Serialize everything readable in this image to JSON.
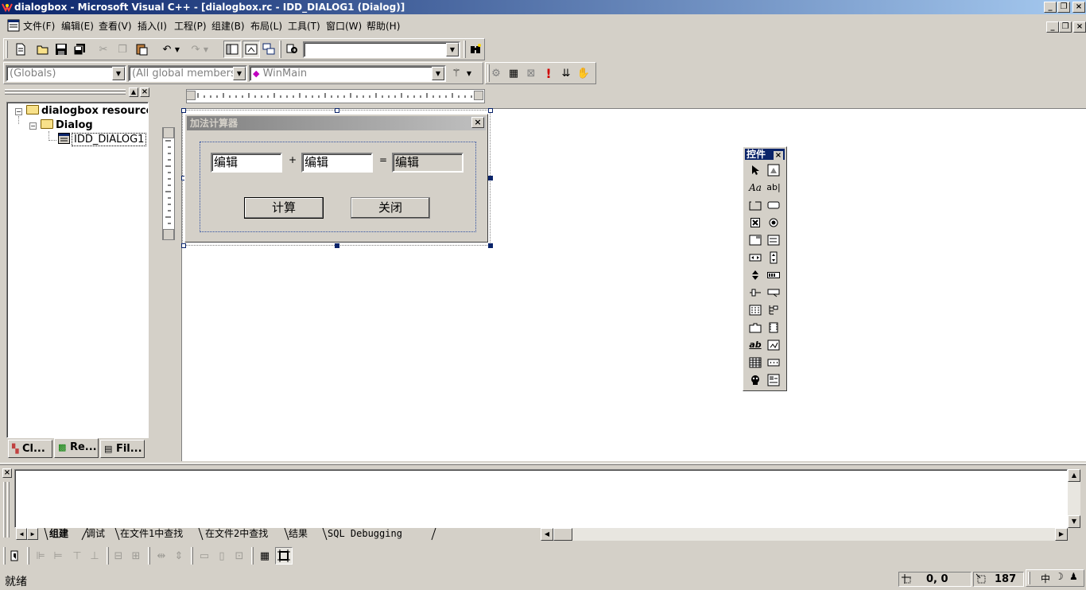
{
  "window": {
    "title": "dialogbox - Microsoft Visual C++ - [dialogbox.rc - IDD_DIALOG1 (Dialog)]",
    "min_glyph": "_",
    "restore_glyph": "❐",
    "close_glyph": "×"
  },
  "menu": {
    "items": [
      "文件(F)",
      "编辑(E)",
      "查看(V)",
      "插入(I)",
      "工程(P)",
      "组建(B)",
      "布局(L)",
      "工具(T)",
      "窗口(W)",
      "帮助(H)"
    ]
  },
  "toolbar": {
    "find_value": ""
  },
  "wizardbar": {
    "class_combo": "(Globals)",
    "filter_combo": "(All global members",
    "members_combo": "WinMain"
  },
  "workspace": {
    "root": "dialogbox resources",
    "folder": "Dialog",
    "dialog_item": "IDD_DIALOG1",
    "tabs": [
      "Cl...",
      "Re...",
      "Fil..."
    ]
  },
  "dialog": {
    "title": "加法计算器",
    "close_glyph": "×",
    "edit1": "编辑",
    "plus": "+",
    "edit2": "编辑",
    "equals": "=",
    "edit3": "编辑",
    "calc_button": "计算",
    "close_button": "关闭"
  },
  "palette": {
    "title": "控件",
    "close_glyph": "×",
    "text_glyph": "Aa",
    "edit_glyph": "ab|",
    "richedit_glyph": "ab"
  },
  "output": {
    "tabs": [
      "组建",
      "调试",
      "在文件1中查找",
      "在文件2中查找",
      "结果",
      "SQL Debugging"
    ]
  },
  "status": {
    "text": "就绪",
    "position": "0, 0",
    "size": "187 ×",
    "ime_lang": "中"
  }
}
